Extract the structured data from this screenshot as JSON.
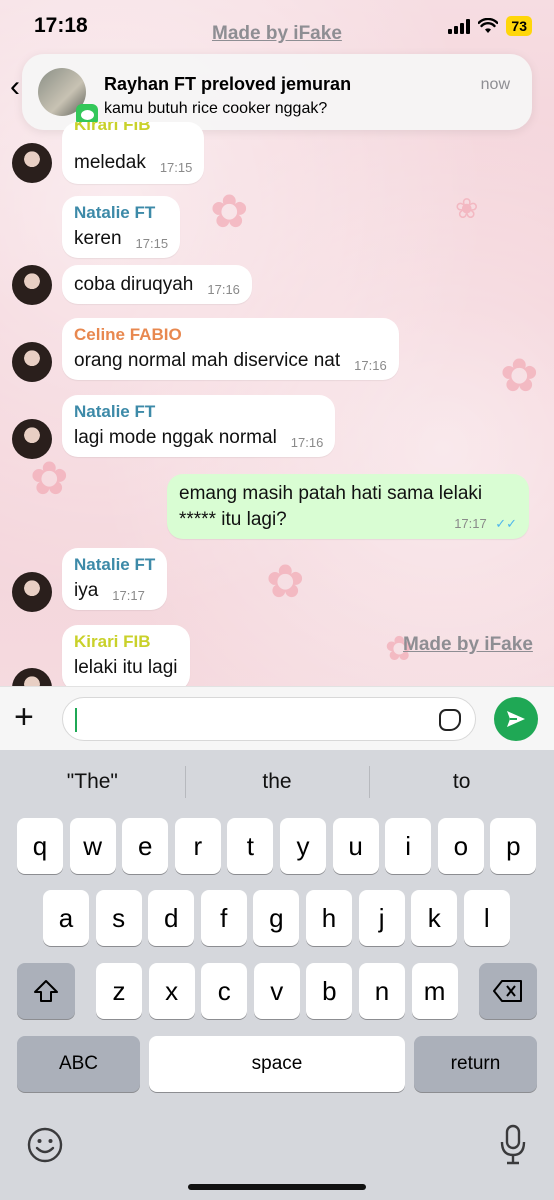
{
  "status_bar": {
    "time": "17:18",
    "battery": "73",
    "watermark": "Made by iFake"
  },
  "notification": {
    "title": "Rayhan FT preloved jemuran",
    "body": "kamu butuh rice cooker nggak?",
    "time": "now"
  },
  "messages": [
    {
      "sender": "Kirari FIB",
      "sender_color": "#c9d12a",
      "text": "meledak",
      "time": "17:15",
      "direction": "in"
    },
    {
      "sender": "Natalie FT",
      "sender_color": "#3d8aa8",
      "text": "keren",
      "time": "17:15",
      "direction": "in"
    },
    {
      "sender": "",
      "text": "coba diruqyah",
      "time": "17:16",
      "direction": "in"
    },
    {
      "sender": "Celine FABIO",
      "sender_color": "#e8884f",
      "text": "orang normal mah diservice nat",
      "time": "17:16",
      "direction": "in"
    },
    {
      "sender": "Natalie FT",
      "sender_color": "#3d8aa8",
      "text": "lagi mode nggak normal",
      "time": "17:16",
      "direction": "in"
    },
    {
      "sender": "",
      "text_line1": "emang masih patah hati sama lelaki",
      "text_line2": "***** itu lagi?",
      "time": "17:17",
      "direction": "out",
      "status": "read"
    },
    {
      "sender": "Natalie FT",
      "sender_color": "#3d8aa8",
      "text": "iya",
      "time": "17:17",
      "direction": "in"
    },
    {
      "sender": "Kirari FIB",
      "sender_color": "#c9d12a",
      "text": "lelaki itu lagi",
      "time": "",
      "direction": "in"
    }
  ],
  "chat_watermark": "Made by iFake",
  "composer": {
    "value": ""
  },
  "keyboard": {
    "suggestions": [
      "\"The\"",
      "the",
      "to"
    ],
    "row1": [
      "q",
      "w",
      "e",
      "r",
      "t",
      "y",
      "u",
      "i",
      "o",
      "p"
    ],
    "row2": [
      "a",
      "s",
      "d",
      "f",
      "g",
      "h",
      "j",
      "k",
      "l"
    ],
    "row3": [
      "z",
      "x",
      "c",
      "v",
      "b",
      "n",
      "m"
    ],
    "abc_label": "ABC",
    "space_label": "space",
    "return_label": "return"
  },
  "icons": [
    "back-chevron-icon",
    "messages-app-icon",
    "plus-icon",
    "sticker-icon",
    "send-icon",
    "shift-icon",
    "backspace-icon",
    "emoji-icon",
    "microphone-icon",
    "wifi-icon",
    "signal-icon"
  ]
}
